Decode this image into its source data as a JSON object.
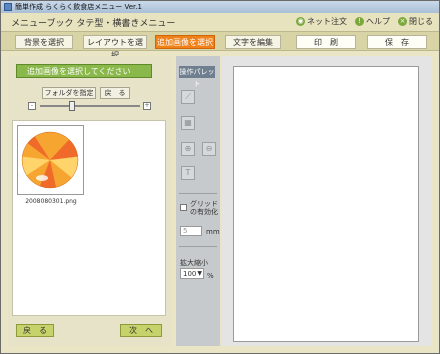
{
  "window": {
    "title": "簡単作成 らくらく飲食店メニュー Ver.1"
  },
  "header": {
    "app_title": "メニューブック タテ型・横書きメニュー",
    "links": [
      {
        "label": "ネット注文",
        "icon": "globe-icon"
      },
      {
        "label": "ヘルプ",
        "icon": "help-icon"
      },
      {
        "label": "閉じる",
        "icon": "close-icon"
      }
    ]
  },
  "steps": [
    {
      "label": "背景を選択"
    },
    {
      "label": "レイアウトを選択"
    },
    {
      "label": "追加画像を選択",
      "active": true
    },
    {
      "label": "文字を編集"
    }
  ],
  "actions": {
    "print": "印　刷",
    "save": "保　存"
  },
  "left": {
    "select_prompt": "追加画像を選択してください",
    "folder_button": "フォルダを指定",
    "back_small": "戻　る",
    "thumbs": [
      {
        "filename": "2008080301.png"
      }
    ],
    "back": "戻　る",
    "next": "次　へ"
  },
  "palette": {
    "title": "操作パレット",
    "grid_label_1": "グリッド",
    "grid_label_2": "の有効化",
    "grid_value": "5",
    "grid_unit": "mm",
    "zoom_label": "拡大縮小",
    "zoom_value": "100",
    "zoom_unit": "%"
  },
  "colors": {
    "active_step": "#f08018",
    "accent_green": "#8ab84a"
  }
}
